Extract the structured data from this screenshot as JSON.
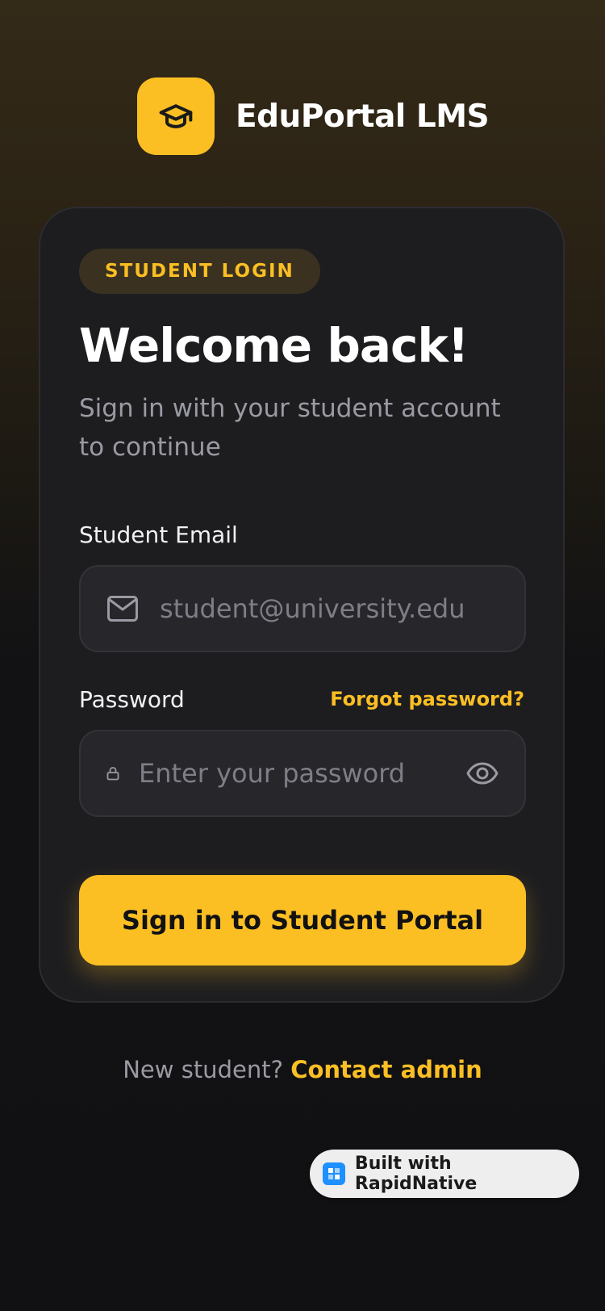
{
  "app": {
    "name": "EduPortal LMS",
    "logo_icon": "graduation-cap-icon",
    "accent_color": "#fbbf24"
  },
  "card": {
    "badge": "STUDENT LOGIN",
    "title": "Welcome back!",
    "subtitle": "Sign in with your student account to continue"
  },
  "form": {
    "email": {
      "label": "Student Email",
      "placeholder": "student@university.edu",
      "value": "",
      "icon": "mail-icon"
    },
    "password": {
      "label": "Password",
      "placeholder": "Enter your password",
      "value": "",
      "icon": "lock-icon",
      "toggle_icon": "eye-icon",
      "forgot_link": "Forgot password?"
    },
    "submit_label": "Sign in to Student Portal"
  },
  "footer": {
    "prompt": "New student?",
    "link": "Contact admin"
  },
  "builder_badge": {
    "label": "Built with RapidNative",
    "icon": "rapidnative-logo-icon"
  }
}
